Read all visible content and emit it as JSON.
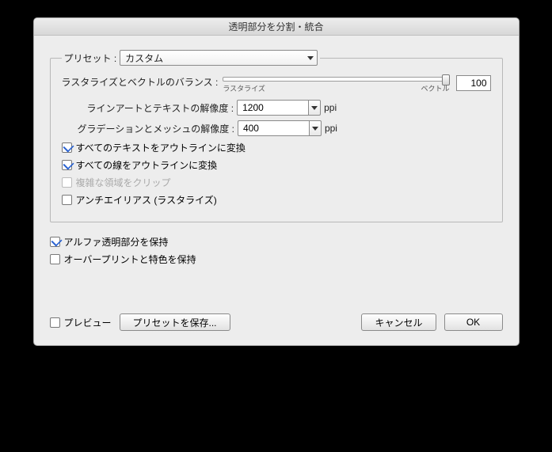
{
  "title": "透明部分を分割・統合",
  "preset": {
    "label": "プリセット :",
    "value": "カスタム"
  },
  "balance": {
    "label": "ラスタライズとベクトルのバランス :",
    "left_tick": "ラスタライズ",
    "right_tick": "ベクトル",
    "value": "100"
  },
  "lineart": {
    "label": "ラインアートとテキストの解像度 :",
    "value": "1200",
    "unit": "ppi"
  },
  "gradient": {
    "label": "グラデーションとメッシュの解像度 :",
    "value": "400",
    "unit": "ppi"
  },
  "checks": {
    "text_outline": {
      "label": "すべてのテキストをアウトラインに変換",
      "checked": true
    },
    "stroke_outline": {
      "label": "すべての線をアウトラインに変換",
      "checked": true
    },
    "clip_complex": {
      "label": "複雑な領域をクリップ",
      "checked": false,
      "disabled": true
    },
    "antialias": {
      "label": "アンチエイリアス (ラスタライズ)",
      "checked": false
    }
  },
  "outer": {
    "alpha": {
      "label": "アルファ透明部分を保持",
      "checked": true
    },
    "overprint": {
      "label": "オーバープリントと特色を保持",
      "checked": false
    }
  },
  "footer": {
    "preview": "プレビュー",
    "save_preset": "プリセットを保存...",
    "cancel": "キャンセル",
    "ok": "OK"
  }
}
